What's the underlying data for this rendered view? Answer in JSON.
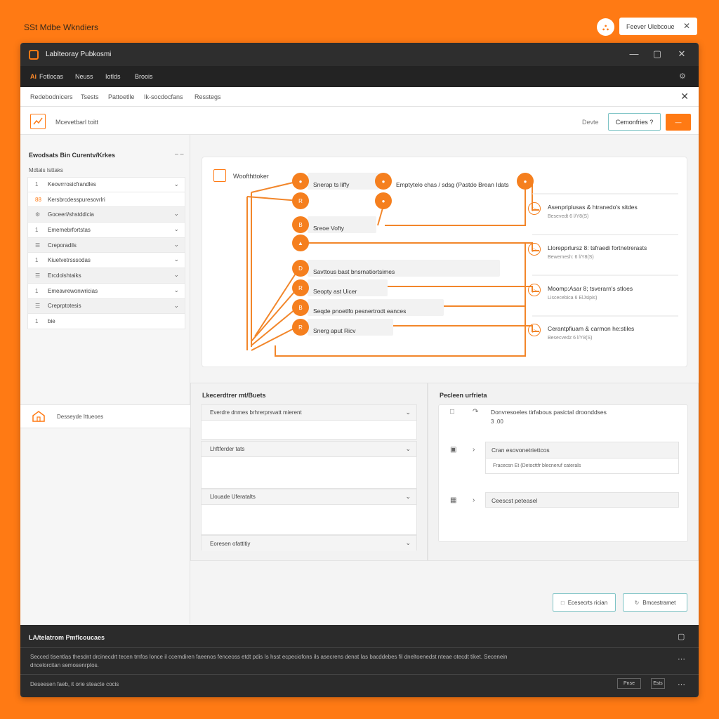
{
  "page": {
    "title": "SSt  Mdbe Wkndiers",
    "user_initial": "⛬",
    "popup_label": "Feever Ulebcoue",
    "popup_close": "✕"
  },
  "window": {
    "title": "Lablteoray Pubkosmi",
    "controls": {
      "minimize": "—",
      "maximize": "▢",
      "close": "✕"
    }
  },
  "menubar": {
    "items": [
      {
        "prefix": "Ai",
        "label": "Fotlocas"
      },
      {
        "prefix": "",
        "label": "Neuss"
      },
      {
        "prefix": "",
        "label": "Iotlds"
      },
      {
        "prefix": "",
        "label": "Broois"
      }
    ],
    "settings_icon": "⚙"
  },
  "tabs": {
    "items": [
      "Redebodnicers",
      "Tsests",
      "Pattoetlle",
      "Ik-socdocfans",
      "Resstegs"
    ],
    "close": "✕"
  },
  "toolbar": {
    "label": "Mcevetbarl toitt",
    "link": "Devte",
    "button_outline": "Cemonfries ?",
    "button_fill": "—"
  },
  "sidebar": {
    "heading": "Ewodsats Bin Curentv/Krkes",
    "heading_more": "–  –",
    "subheading": "Mdtals Isttaks",
    "rows": [
      {
        "icon": "1",
        "label": "Keovrrrosicfrandles",
        "group": false
      },
      {
        "icon": "88",
        "label": "Kersbrcdesspuresovrlri",
        "group": false
      },
      {
        "icon": "⚙",
        "label": "Goceerl/shstddicia",
        "group": true
      },
      {
        "icon": "1",
        "label": "Ememebrfortstas",
        "group": false
      },
      {
        "icon": "☰",
        "label": "Creporadils",
        "group": true
      },
      {
        "icon": "1",
        "label": "Kiuetvetrsssodas",
        "group": false
      },
      {
        "icon": "☰",
        "label": "Ercdolshtaiks",
        "group": true
      },
      {
        "icon": "1",
        "label": "Emeavrewonwricias",
        "group": false
      },
      {
        "icon": "☰",
        "label": "Creprptotesis",
        "group": true
      },
      {
        "icon": "1",
        "label": "bie",
        "group": false
      }
    ],
    "bottom_label": "Desseyde Ittueoes"
  },
  "workflow": {
    "title": "Woofthttoker",
    "nodes": [
      {
        "label": "Snerap ts liffy",
        "glyph": "●"
      },
      {
        "label": "",
        "glyph": "R"
      },
      {
        "label": "Sreoe Vofty",
        "glyph": "B"
      },
      {
        "label": "",
        "glyph": "▲"
      },
      {
        "label": "Savttous bast bnsrnatiortsimes",
        "glyph": "D"
      },
      {
        "label": "Seopty ast Uicer",
        "glyph": "R"
      },
      {
        "label": "Seqde pnoetlfo pesnertrodt eances",
        "glyph": "B"
      },
      {
        "label": "Snerg aput Ricv",
        "glyph": "R"
      }
    ],
    "top_node": {
      "label": "Emptytelo chas / sdsg (Pastdo Brean Idats",
      "glyph": "●"
    },
    "top_node_b": {
      "glyph": "●"
    },
    "top_node_c": {
      "glyph": "●"
    },
    "outputs": [
      {
        "label": "Asenpriplusas & htranedo's sitdes",
        "sub": "Besevedt 6 l/Y8(S)"
      },
      {
        "label": "Llorepprlursz 8: tsfraedi fortnetrerasts",
        "sub": "Bewemesh: 6 l/Y8(S)"
      },
      {
        "label": "Moomp:Asar 8; tsverarn's stloes",
        "sub": "Liscecebica 6 ElJsipis)"
      },
      {
        "label": "Cerantpfiuam & carmon he:stiles",
        "sub": "Besecvedz 6 l/Y8(S)"
      }
    ]
  },
  "panel_left": {
    "title": "Lkecerdtrer mt/Buets",
    "sections": [
      {
        "label": "Everdre dnmes brhrerprsvatt mierent"
      },
      {
        "label": "Lhftferder tats"
      },
      {
        "label": "Llouade Uferatalts"
      },
      {
        "label": "Eoresen ofattitiy"
      }
    ]
  },
  "panel_right": {
    "title": "Pecleen urfrieta",
    "item1": {
      "text": "Donvresoeles tirfabous pasictal droonddses",
      "sub": "3 .00"
    },
    "item2": {
      "title": "Cran esovonetriettcos",
      "sub": "Fracecsn Et (Detocttfr blecneruf caterals"
    },
    "item3": {
      "title": "Ceescst peteasel"
    }
  },
  "footer_buttons": {
    "first": "Ecesecrts rician",
    "second": "Bmcestramet"
  },
  "console": {
    "title": "LA/telatrom Pmflcoucaes",
    "text": "Secced tisentlas thesdnt drcinecdrt tecen tmfos lonce il ccemdiren faeenos fenceoss etdt pdis Is hsst ecpeciofons ils asecrens denat Ias bacddebes fil dneltoenedst nteae otecdt tiket. Secenein dncelorcitan semosenrptos.",
    "status": "Deseesen faeb, it orie steacte cocis",
    "btn1": "Pnse",
    "btn2": "Ests"
  },
  "colors": {
    "accent": "#ff7a14",
    "teal": "#7fc4c6",
    "dark": "#2b2b2b"
  }
}
